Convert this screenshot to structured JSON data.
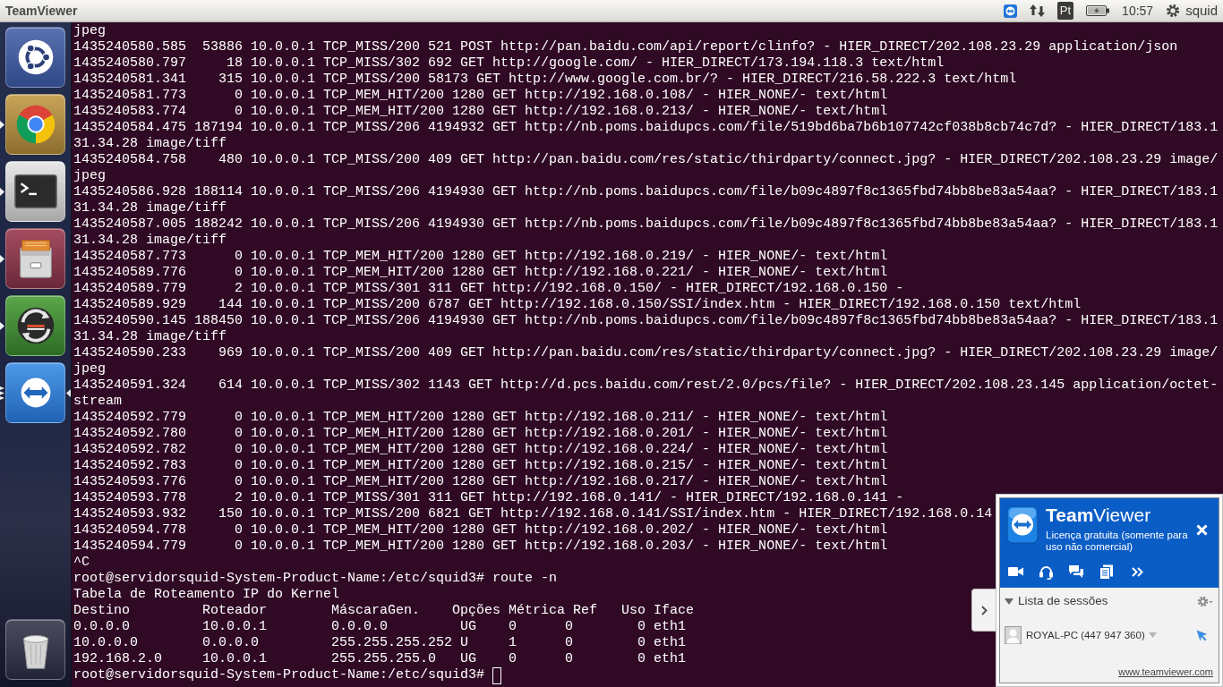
{
  "top_panel": {
    "title": "TeamViewer",
    "keyboard_layout": "Pt",
    "clock": "10:57",
    "user": "squid"
  },
  "launcher": {
    "items": [
      {
        "kind": "dash",
        "running": false,
        "several_windows": false,
        "focused": false
      },
      {
        "kind": "browser",
        "running": true,
        "several_windows": false,
        "focused": false
      },
      {
        "kind": "terminal",
        "running": true,
        "several_windows": false,
        "focused": false
      },
      {
        "kind": "files",
        "running": true,
        "several_windows": false,
        "focused": false
      },
      {
        "kind": "updater",
        "running": true,
        "several_windows": false,
        "focused": false
      },
      {
        "kind": "teamviewer",
        "running": true,
        "several_windows": true,
        "focused": true
      },
      {
        "kind": "trash",
        "running": false,
        "several_windows": false,
        "focused": false
      }
    ]
  },
  "terminal": {
    "lines": [
      "jpeg",
      "1435240580.585  53886 10.0.0.1 TCP_MISS/200 521 POST http://pan.baidu.com/api/report/clinfo? - HIER_DIRECT/202.108.23.29 application/json",
      "1435240580.797     18 10.0.0.1 TCP_MISS/302 692 GET http://google.com/ - HIER_DIRECT/173.194.118.3 text/html",
      "1435240581.341    315 10.0.0.1 TCP_MISS/200 58173 GET http://www.google.com.br/? - HIER_DIRECT/216.58.222.3 text/html",
      "1435240581.773      0 10.0.0.1 TCP_MEM_HIT/200 1280 GET http://192.168.0.108/ - HIER_NONE/- text/html",
      "1435240583.774      0 10.0.0.1 TCP_MEM_HIT/200 1280 GET http://192.168.0.213/ - HIER_NONE/- text/html",
      "1435240584.475 187194 10.0.0.1 TCP_MISS/206 4194932 GET http://nb.poms.baidupcs.com/file/519bd6ba7b6b107742cf038b8cb74c7d? - HIER_DIRECT/183.1",
      "31.34.28 image/tiff",
      "1435240584.758    480 10.0.0.1 TCP_MISS/200 409 GET http://pan.baidu.com/res/static/thirdparty/connect.jpg? - HIER_DIRECT/202.108.23.29 image/",
      "jpeg",
      "1435240586.928 188114 10.0.0.1 TCP_MISS/206 4194930 GET http://nb.poms.baidupcs.com/file/b09c4897f8c1365fbd74bb8be83a54aa? - HIER_DIRECT/183.1",
      "31.34.28 image/tiff",
      "1435240587.005 188242 10.0.0.1 TCP_MISS/206 4194930 GET http://nb.poms.baidupcs.com/file/b09c4897f8c1365fbd74bb8be83a54aa? - HIER_DIRECT/183.1",
      "31.34.28 image/tiff",
      "1435240587.773      0 10.0.0.1 TCP_MEM_HIT/200 1280 GET http://192.168.0.219/ - HIER_NONE/- text/html",
      "1435240589.776      0 10.0.0.1 TCP_MEM_HIT/200 1280 GET http://192.168.0.221/ - HIER_NONE/- text/html",
      "1435240589.779      2 10.0.0.1 TCP_MISS/301 311 GET http://192.168.0.150/ - HIER_DIRECT/192.168.0.150 -",
      "1435240589.929    144 10.0.0.1 TCP_MISS/200 6787 GET http://192.168.0.150/SSI/index.htm - HIER_DIRECT/192.168.0.150 text/html",
      "1435240590.145 188450 10.0.0.1 TCP_MISS/206 4194930 GET http://nb.poms.baidupcs.com/file/b09c4897f8c1365fbd74bb8be83a54aa? - HIER_DIRECT/183.1",
      "31.34.28 image/tiff",
      "1435240590.233    969 10.0.0.1 TCP_MISS/200 409 GET http://pan.baidu.com/res/static/thirdparty/connect.jpg? - HIER_DIRECT/202.108.23.29 image/",
      "jpeg",
      "1435240591.324    614 10.0.0.1 TCP_MISS/302 1143 GET http://d.pcs.baidu.com/rest/2.0/pcs/file? - HIER_DIRECT/202.108.23.145 application/octet-",
      "stream",
      "1435240592.779      0 10.0.0.1 TCP_MEM_HIT/200 1280 GET http://192.168.0.211/ - HIER_NONE/- text/html",
      "1435240592.780      0 10.0.0.1 TCP_MEM_HIT/200 1280 GET http://192.168.0.201/ - HIER_NONE/- text/html",
      "1435240592.782      0 10.0.0.1 TCP_MEM_HIT/200 1280 GET http://192.168.0.224/ - HIER_NONE/- text/html",
      "1435240592.783      0 10.0.0.1 TCP_MEM_HIT/200 1280 GET http://192.168.0.215/ - HIER_NONE/- text/html",
      "1435240593.776      0 10.0.0.1 TCP_MEM_HIT/200 1280 GET http://192.168.0.217/ - HIER_NONE/- text/html",
      "1435240593.778      2 10.0.0.1 TCP_MISS/301 311 GET http://192.168.0.141/ - HIER_DIRECT/192.168.0.141 -",
      "1435240593.932    150 10.0.0.1 TCP_MISS/200 6821 GET http://192.168.0.141/SSI/index.htm - HIER_DIRECT/192.168.0.14",
      "1435240594.778      0 10.0.0.1 TCP_MEM_HIT/200 1280 GET http://192.168.0.202/ - HIER_NONE/- text/html",
      "1435240594.779      0 10.0.0.1 TCP_MEM_HIT/200 1280 GET http://192.168.0.203/ - HIER_NONE/- text/html",
      "^C",
      "root@servidorsquid-System-Product-Name:/etc/squid3# route -n",
      "Tabela de Roteamento IP do Kernel",
      "Destino         Roteador        MáscaraGen.    Opções Métrica Ref   Uso Iface",
      "0.0.0.0         10.0.0.1        0.0.0.0         UG    0      0        0 eth1",
      "10.0.0.0        0.0.0.0         255.255.255.252 U     1      0        0 eth1",
      "192.168.2.0     10.0.0.1        255.255.255.0   UG    0      0        0 eth1"
    ],
    "prompt": "root@servidorsquid-System-Product-Name:/etc/squid3#"
  },
  "teamviewer_panel": {
    "title": "**Team**Viewer",
    "license": "Licença gratuita (somente para uso não comercial)",
    "sessions": {
      "heading": "Lista de sessões",
      "expanded": true,
      "items": [
        {
          "name": "ROYAL-PC (447 947 360)"
        }
      ]
    },
    "link": "www.teamviewer.com"
  }
}
